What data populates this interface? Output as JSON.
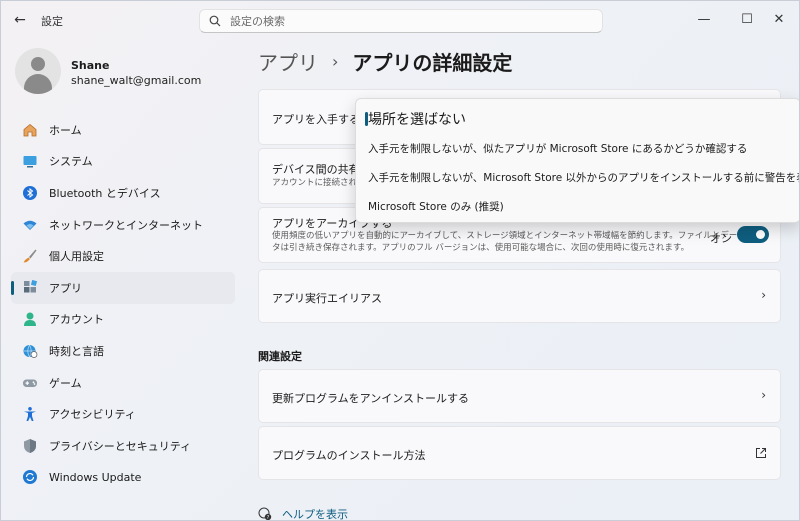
{
  "window": {
    "title": "設定",
    "back": "←",
    "minimize": "—",
    "maximize": "☐",
    "close": "✕"
  },
  "search": {
    "placeholder": "設定の検索"
  },
  "profile": {
    "name": "Shane",
    "email": "shane_walt@gmail.com"
  },
  "sidebar": {
    "items": [
      {
        "label": "ホーム",
        "icon": "home-icon"
      },
      {
        "label": "システム",
        "icon": "system-icon"
      },
      {
        "label": "Bluetooth とデバイス",
        "icon": "bluetooth-icon"
      },
      {
        "label": "ネットワークとインターネット",
        "icon": "wifi-icon"
      },
      {
        "label": "個人用設定",
        "icon": "brush-icon"
      },
      {
        "label": "アプリ",
        "icon": "apps-icon",
        "active": true
      },
      {
        "label": "アカウント",
        "icon": "account-icon"
      },
      {
        "label": "時刻と言語",
        "icon": "globe-clock-icon"
      },
      {
        "label": "ゲーム",
        "icon": "gamepad-icon"
      },
      {
        "label": "アクセシビリティ",
        "icon": "accessibility-icon"
      },
      {
        "label": "プライバシーとセキュリティ",
        "icon": "shield-icon"
      },
      {
        "label": "Windows Update",
        "icon": "update-icon"
      }
    ]
  },
  "breadcrumb": {
    "parent": "アプリ",
    "separator": "›",
    "current": "アプリの詳細設定"
  },
  "main": {
    "install_source": {
      "label": "アプリを入手する場"
    },
    "device_share": {
      "label": "デバイス間の共有",
      "desc": "アカウントに接続されて"
    },
    "archive": {
      "label": "アプリをアーカイブする",
      "desc1": "使用頻度の低いアプリを自動的にアーカイブして、ストレージ領域とインターネット帯域幅を節約します。ファイルとデー",
      "desc2": "タは引き続き保存されます。アプリのフル バージョンは、使用可能な場合に、次回の使用時に復元されます。",
      "toggle_state": "オン"
    },
    "aliases": {
      "label": "アプリ実行エイリアス"
    },
    "related_title": "関連設定",
    "uninstall_updates": {
      "label": "更新プログラムをアンインストールする"
    },
    "how_to_install": {
      "label": "プログラムのインストール方法"
    },
    "chevron": "›"
  },
  "help": {
    "label": "ヘルプを表示"
  },
  "dropdown": {
    "options": [
      "場所を選ばない",
      "入手元を制限しないが、似たアプリが Microsoft Store にあるかどうか確認する",
      "入手元を制限しないが、Microsoft Store 以外からのアプリをインストールする前に警告を表示する",
      "Microsoft Store のみ (推奨)"
    ],
    "selected_index": 0
  },
  "colors": {
    "accent": "#0f5e80"
  }
}
